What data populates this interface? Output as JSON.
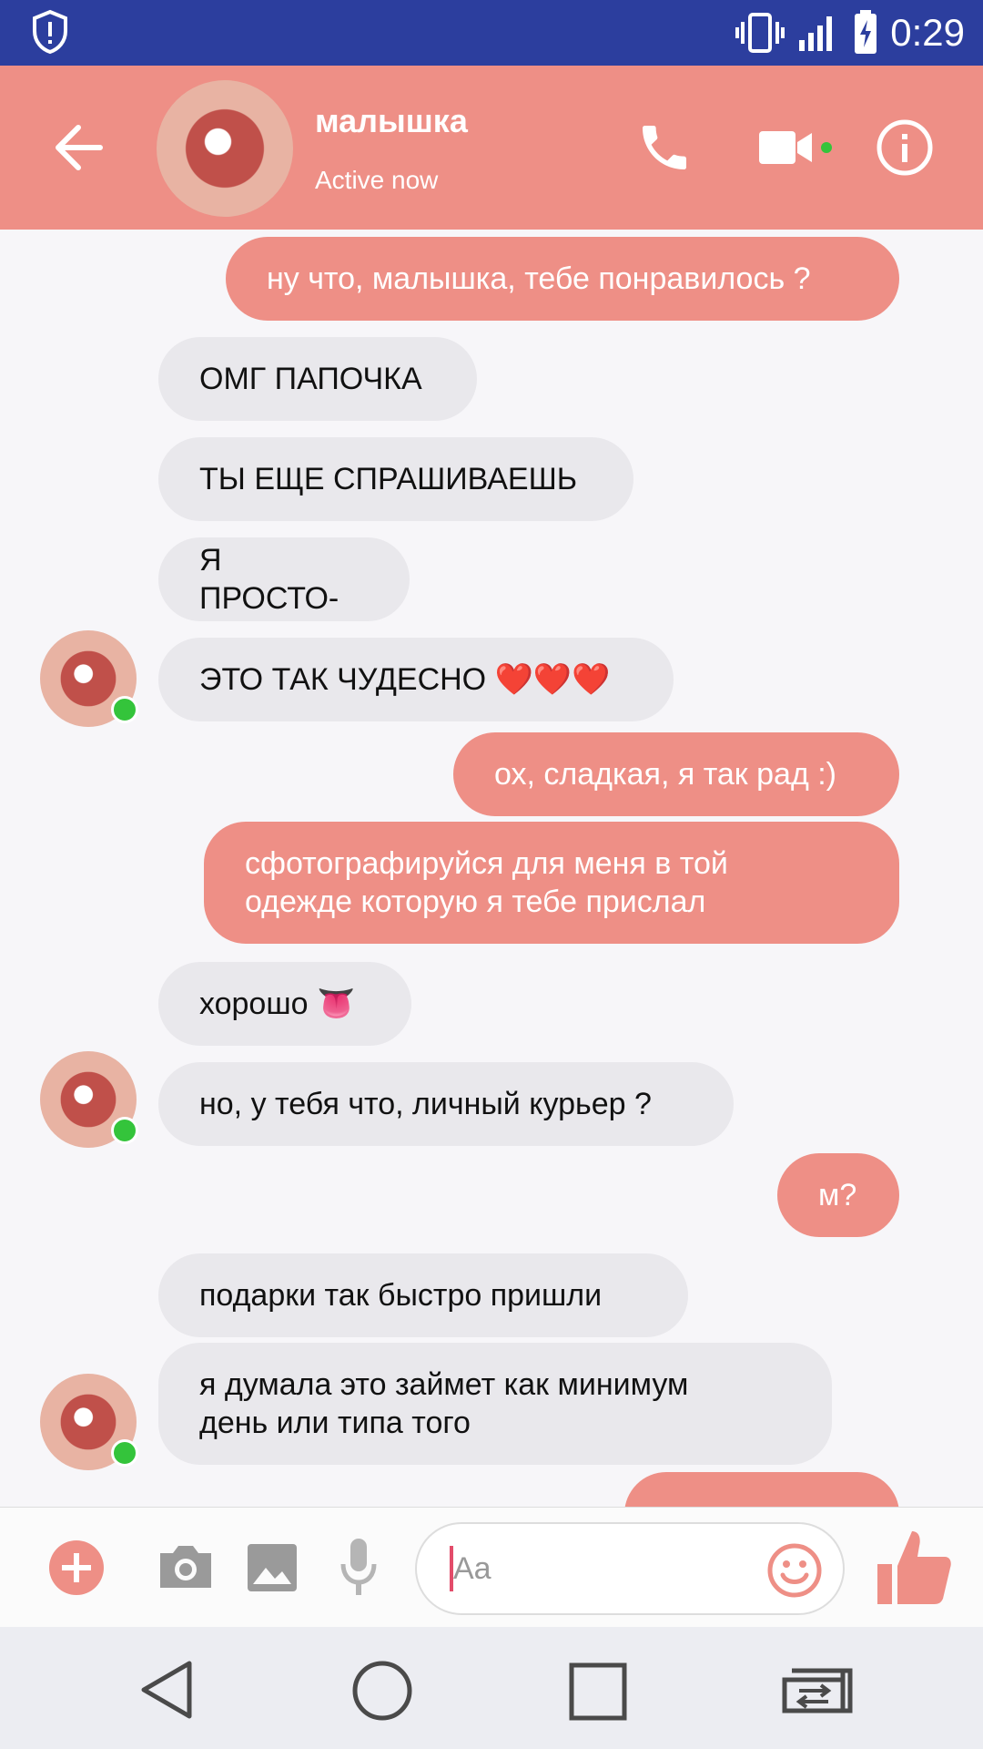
{
  "status_bar": {
    "time": "0:29",
    "icons": [
      "shield-alert-icon",
      "vibrate-icon",
      "signal-icon",
      "battery-charging-icon"
    ]
  },
  "header": {
    "contact_name": "малышка",
    "contact_status": "Active now",
    "icons": [
      "back-arrow-icon",
      "phone-icon",
      "video-call-icon",
      "info-icon"
    ]
  },
  "messages": [
    {
      "side": "out",
      "text": "ну что, малышка, тебе понравилось ?"
    },
    {
      "side": "in",
      "text": "ОМГ ПАПОЧКА"
    },
    {
      "side": "in",
      "text": "ТЫ ЕЩЕ СПРАШИВАЕШЬ"
    },
    {
      "side": "in",
      "text": "Я ПРОСТО-"
    },
    {
      "side": "in",
      "text": "ЭТО ТАК ЧУДЕСНО ❤️❤️❤️"
    },
    {
      "side": "out",
      "text": "ох, сладкая, я так рад :)"
    },
    {
      "side": "out",
      "text": "сфотографируйся для меня в той\nодежде которую я тебе прислал"
    },
    {
      "side": "in",
      "text": "хорошо 👅"
    },
    {
      "side": "in",
      "text": "но, у тебя что, личный курьер ?"
    },
    {
      "side": "out",
      "text": "м?"
    },
    {
      "side": "in",
      "text": "подарки так быстро пришли"
    },
    {
      "side": "in",
      "text": "я думала это займет как минимум\nдень или типа того"
    }
  ],
  "composer": {
    "placeholder": "Aa",
    "icons": [
      "plus-icon",
      "camera-icon",
      "image-icon",
      "microphone-icon",
      "emoji-icon",
      "thumbs-up-icon"
    ]
  },
  "nav_bar": {
    "icons": [
      "back-triangle-icon",
      "home-circle-icon",
      "recents-square-icon",
      "switch-apps-icon"
    ]
  },
  "colors": {
    "status_bar": "#2c3e9e",
    "accent": "#ee8f86",
    "incoming_bubble": "#e9e8ec",
    "online": "#34c43b"
  }
}
